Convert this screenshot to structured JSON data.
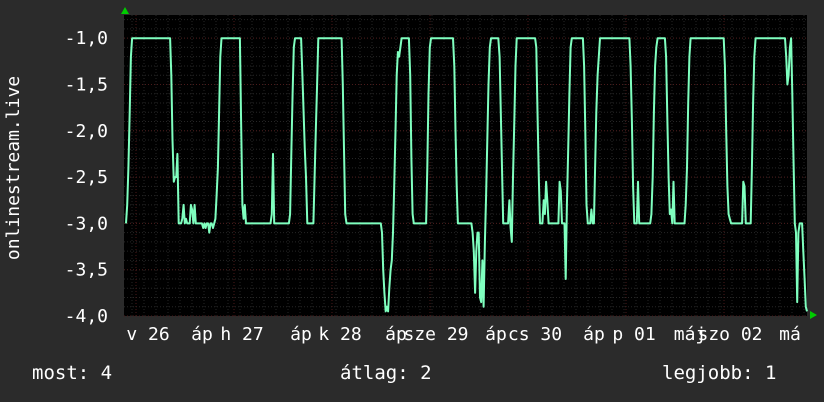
{
  "chart_data": {
    "type": "line",
    "ylabel": "onlinestream.live",
    "ylim": [
      -4.0,
      -0.75
    ],
    "y_ticks": [
      "-1,0",
      "-1,5",
      "-2,0",
      "-2,5",
      "-3,0",
      "-3,5",
      "-4,0"
    ],
    "x_ticks": [
      "v 26",
      "áp",
      "h 27",
      "áp",
      "k 28",
      "áp",
      "sze 29",
      "áp",
      "cs 30",
      "áp",
      "p 01",
      "máj",
      "szo 02",
      "má"
    ],
    "grid": true,
    "colors": {
      "background": "#2b2b2b",
      "plot_bg": "#000000",
      "grid_major": "#4a1a1a",
      "grid_minor": "#262626",
      "line": "#7fffbf",
      "axis_marker": "#00cc00"
    },
    "series": [
      {
        "values": [
          -3,
          -2.8,
          -2.4,
          -1.8,
          -1.2,
          -1,
          -1,
          -1,
          -1,
          -1,
          -1,
          -1,
          -1,
          -1,
          -1,
          -1,
          -1,
          -1,
          -1,
          -1,
          -1,
          -1,
          -1,
          -1,
          -1,
          -1,
          -1,
          -1,
          -1,
          -1,
          -1,
          -1,
          -1,
          -1,
          -1,
          -1,
          -1,
          -1.4,
          -2.1,
          -2.55,
          -2.5,
          -2.5,
          -2.25,
          -3,
          -3,
          -3,
          -2.95,
          -2.8,
          -3,
          -2.95,
          -3,
          -3,
          -3,
          -2.8,
          -2.85,
          -3,
          -2.8,
          -3,
          -3,
          -3,
          -3,
          -3,
          -3,
          -3.05,
          -3,
          -3.05,
          -3,
          -3,
          -3.1,
          -3,
          -3,
          -3.05,
          -3,
          -2.95,
          -2.7,
          -2.4,
          -1.8,
          -1.2,
          -1,
          -1,
          -1,
          -1,
          -1,
          -1,
          -1,
          -1,
          -1,
          -1,
          -1,
          -1,
          -1,
          -1,
          -1,
          -1,
          -1.9,
          -2.8,
          -2.95,
          -2.8,
          -3,
          -3,
          -3,
          -3,
          -3,
          -3,
          -3,
          -3,
          -3,
          -3,
          -3,
          -3,
          -3,
          -3,
          -3,
          -3,
          -3,
          -3,
          -3,
          -3,
          -3,
          -2.9,
          -2.25,
          -3,
          -3,
          -3,
          -3,
          -3,
          -3,
          -3,
          -3,
          -3,
          -3,
          -3,
          -3,
          -3,
          -2.9,
          -2.2,
          -1.6,
          -1.1,
          -1,
          -1,
          -1,
          -1,
          -1,
          -1,
          -1.4,
          -1.8,
          -2.2,
          -2.5,
          -3,
          -3,
          -3,
          -3,
          -3,
          -3,
          -2.5,
          -2,
          -1.5,
          -1,
          -1,
          -1,
          -1,
          -1,
          -1,
          -1,
          -1,
          -1,
          -1,
          -1,
          -1,
          -1,
          -1,
          -1,
          -1,
          -1,
          -1,
          -1,
          -1,
          -1.5,
          -2.2,
          -2.9,
          -3,
          -3,
          -3,
          -3,
          -3,
          -3,
          -3,
          -3,
          -3,
          -3,
          -3,
          -3,
          -3,
          -3,
          -3,
          -3,
          -3,
          -3,
          -3,
          -3,
          -3,
          -3,
          -3,
          -3,
          -3,
          -3,
          -3,
          -3,
          -3,
          -3.1,
          -3.5,
          -3.75,
          -3.95,
          -3.9,
          -3.95,
          -3.7,
          -3.5,
          -3.4,
          -3.1,
          -2.6,
          -2,
          -1.4,
          -1.15,
          -1.2,
          -1.1,
          -1,
          -1,
          -1,
          -1,
          -1,
          -1,
          -1,
          -1.4,
          -2.3,
          -2.9,
          -3,
          -3,
          -3,
          -3,
          -3,
          -3,
          -3,
          -3,
          -3,
          -3,
          -3,
          -2.4,
          -1.6,
          -1.1,
          -1,
          -1,
          -1,
          -1,
          -1,
          -1,
          -1,
          -1,
          -1,
          -1,
          -1,
          -1,
          -1,
          -1,
          -1,
          -1,
          -1,
          -1,
          -1,
          -1.3,
          -2,
          -2.6,
          -3,
          -3,
          -3,
          -3,
          -3,
          -3,
          -3,
          -3,
          -3,
          -3,
          -3,
          -3,
          -3.1,
          -3.3,
          -3.75,
          -3.3,
          -3.1,
          -3.1,
          -3.8,
          -3.85,
          -3.4,
          -3.9,
          -3.2,
          -2.7,
          -2.1,
          -1.5,
          -1.1,
          -1,
          -1,
          -1,
          -1,
          -1,
          -1,
          -1,
          -1.2,
          -1.8,
          -2.4,
          -3,
          -3,
          -3,
          -3,
          -3,
          -2.75,
          -3.05,
          -3.2,
          -2.5,
          -1.9,
          -1.3,
          -1,
          -1,
          -1,
          -1,
          -1,
          -1,
          -1,
          -1,
          -1,
          -1,
          -1,
          -1,
          -1,
          -1,
          -1,
          -1,
          -1.1,
          -1.8,
          -2.5,
          -3,
          -3,
          -3,
          -2.75,
          -2.9,
          -2.55,
          -2.75,
          -3,
          -3,
          -3,
          -3,
          -3,
          -3,
          -3,
          -3,
          -3,
          -2.55,
          -2.65,
          -3,
          -3,
          -3,
          -3.6,
          -2.8,
          -2.2,
          -1.6,
          -1.1,
          -1,
          -1,
          -1,
          -1,
          -1,
          -1,
          -1,
          -1,
          -1,
          -1,
          -1.3,
          -2,
          -2.8,
          -3,
          -3,
          -3,
          -2.85,
          -3,
          -3,
          -2.4,
          -1.8,
          -1.4,
          -1.2,
          -1,
          -1,
          -1,
          -1,
          -1,
          -1,
          -1,
          -1,
          -1,
          -1,
          -1,
          -1,
          -1,
          -1,
          -1,
          -1,
          -1,
          -1,
          -1,
          -1,
          -1,
          -1,
          -1,
          -1,
          -1,
          -1.3,
          -1.9,
          -2.6,
          -3,
          -3,
          -3,
          -2.55,
          -3,
          -3,
          -3,
          -3,
          -3,
          -3,
          -3,
          -3,
          -3,
          -3,
          -2.9,
          -2.5,
          -1.8,
          -1.3,
          -1.1,
          -1,
          -1,
          -1,
          -1,
          -1,
          -1,
          -1,
          -1.2,
          -1.9,
          -2.5,
          -2.9,
          -2.85,
          -3,
          -2.55,
          -3,
          -3,
          -3,
          -3,
          -3,
          -3,
          -3,
          -3,
          -3,
          -2.8,
          -2.4,
          -1.7,
          -1.2,
          -1,
          -1,
          -1,
          -1,
          -1,
          -1,
          -1,
          -1,
          -1,
          -1,
          -1,
          -1,
          -1,
          -1,
          -1,
          -1,
          -1,
          -1,
          -1,
          -1,
          -1,
          -1,
          -1,
          -1,
          -1,
          -1,
          -1,
          -1,
          -1.3,
          -2,
          -2.6,
          -2.9,
          -2.95,
          -3,
          -3,
          -3,
          -3,
          -3,
          -3,
          -3,
          -3,
          -3,
          -3,
          -2.55,
          -2.6,
          -3,
          -3,
          -3,
          -3,
          -3,
          -2.4,
          -1.7,
          -1.2,
          -1,
          -1,
          -1,
          -1,
          -1,
          -1,
          -1,
          -1,
          -1,
          -1,
          -1,
          -1,
          -1,
          -1,
          -1,
          -1,
          -1,
          -1,
          -1,
          -1,
          -1,
          -1,
          -1,
          -1,
          -1,
          -1.2,
          -1.5,
          -1.4,
          -1.1,
          -1,
          -1.6,
          -2.3,
          -3,
          -3.1,
          -3.85,
          -3.1,
          -3,
          -3,
          -3,
          -3.3,
          -3.6,
          -3.9,
          -3.95
        ]
      }
    ]
  },
  "summary": {
    "now": "most: 4",
    "average": "átlag: 2",
    "best": "legjobb: 1"
  }
}
